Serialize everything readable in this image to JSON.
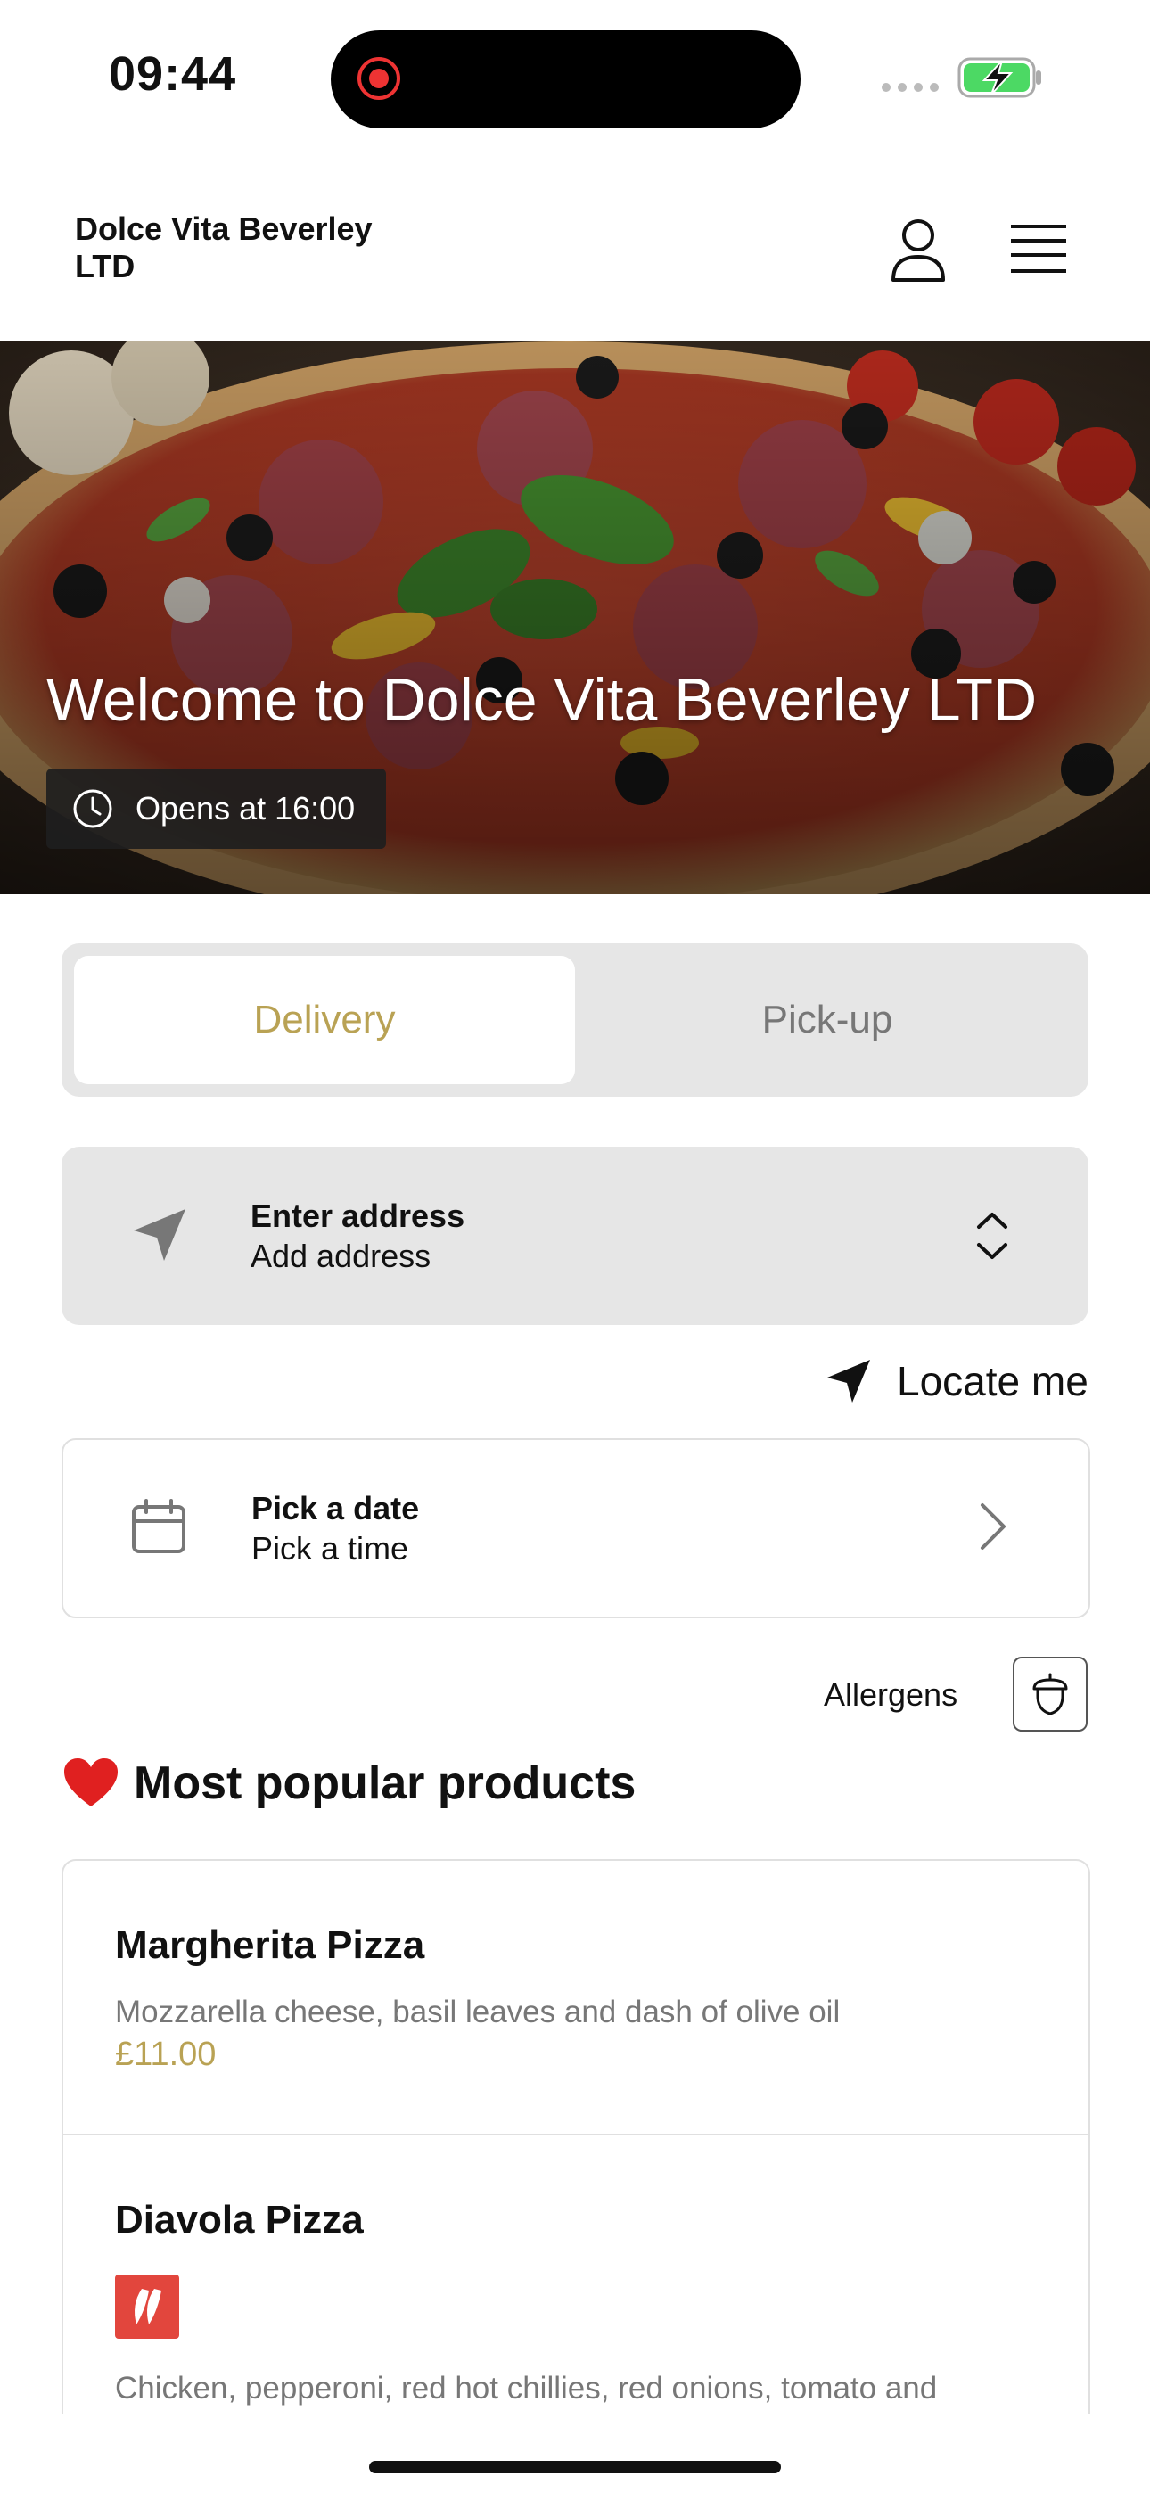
{
  "status_bar": {
    "time": "09:44"
  },
  "header": {
    "brand": "Dolce Vita Beverley LTD"
  },
  "hero": {
    "title": "Welcome to Dolce Vita Beverley LTD",
    "hours": "Opens at 16:00"
  },
  "mode_toggle": {
    "tabs": [
      {
        "label": "Delivery",
        "selected": true
      },
      {
        "label": "Pick-up",
        "selected": false
      }
    ]
  },
  "address": {
    "title": "Enter address",
    "subtitle": "Add address"
  },
  "locate": {
    "label": "Locate me"
  },
  "schedule": {
    "title": "Pick a date",
    "subtitle": "Pick a time"
  },
  "allergens": {
    "label": "Allergens"
  },
  "popular": {
    "title": "Most popular products",
    "products": [
      {
        "name": "Margherita Pizza",
        "description": "Mozzarella cheese, basil leaves and dash of olive oil",
        "price": "£11.00"
      },
      {
        "name": "Diavola Pizza",
        "description": "Chicken, pepperoni, red hot chillies, red onions, tomato and",
        "badge_icon": "chili-icon"
      }
    ]
  },
  "colors": {
    "accent": "#b9a254",
    "toggle_bg": "#e6e6e6",
    "chili_badge": "#e2463d",
    "battery_green": "#4cd964"
  }
}
